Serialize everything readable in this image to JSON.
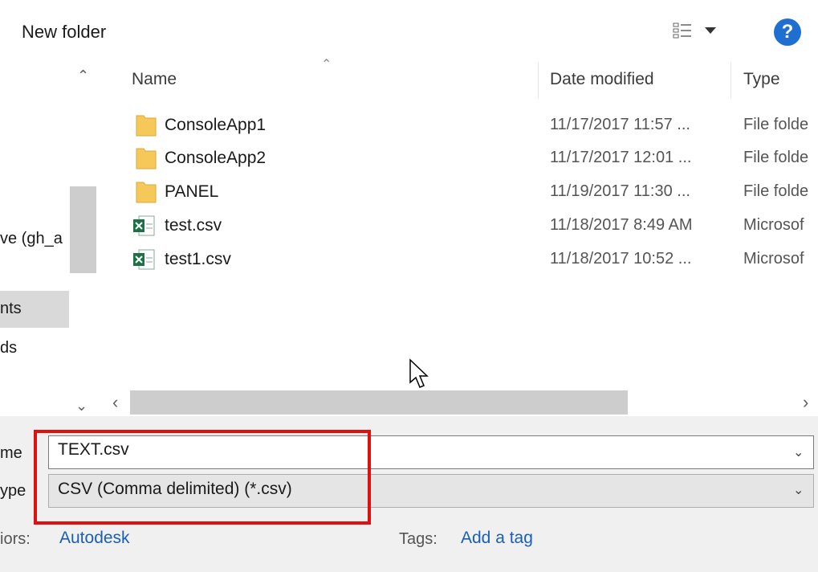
{
  "toolbar": {
    "new_folder_label": "New folder",
    "help_label": "?"
  },
  "nav": {
    "items": [
      "ve (gh_a",
      "nts",
      "ds"
    ]
  },
  "columns": {
    "name": "Name",
    "date_modified": "Date modified",
    "type": "Type"
  },
  "files": [
    {
      "name": "ConsoleApp1",
      "date": "11/17/2017 11:57 ...",
      "type": "File folde",
      "kind": "folder"
    },
    {
      "name": "ConsoleApp2",
      "date": "11/17/2017 12:01 ...",
      "type": "File folde",
      "kind": "folder"
    },
    {
      "name": "PANEL",
      "date": "11/19/2017 11:30 ...",
      "type": "File folde",
      "kind": "folder"
    },
    {
      "name": "test.csv",
      "date": "11/18/2017 8:49 AM",
      "type": "Microsof",
      "kind": "excel"
    },
    {
      "name": "test1.csv",
      "date": "11/18/2017 10:52 ...",
      "type": "Microsof",
      "kind": "excel"
    }
  ],
  "save_panel": {
    "filename_label": "me",
    "filename_value": "TEXT.csv",
    "filetype_label": "ype",
    "filetype_value": "CSV (Comma delimited) (*.csv)",
    "authors_label": "iors:",
    "authors_value": "Autodesk",
    "tags_label": "Tags:",
    "tags_value": "Add a tag"
  },
  "colors": {
    "highlight": "#e01010",
    "link": "#1a5fb4",
    "folder": "#f5c859",
    "excel": "#1e7145"
  }
}
